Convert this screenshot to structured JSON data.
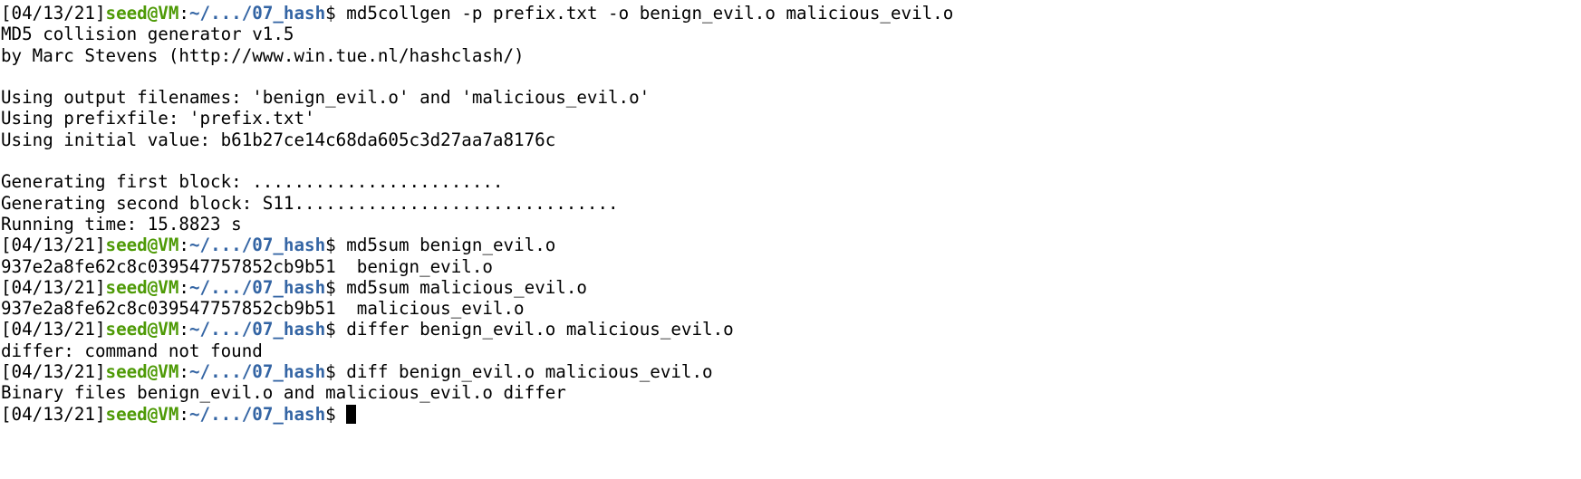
{
  "prompt": {
    "date": "[04/13/21]",
    "user": "seed@VM",
    "sep": ":",
    "path": "~/.../07_hash",
    "symbol": "$ "
  },
  "colors": {
    "user": "#4e9a06",
    "path": "#3465a4",
    "text": "#000000",
    "background": "#ffffff"
  },
  "lines": [
    {
      "type": "cmd",
      "text": "md5collgen -p prefix.txt -o benign_evil.o malicious_evil.o"
    },
    {
      "type": "out",
      "text": "MD5 collision generator v1.5"
    },
    {
      "type": "out",
      "text": "by Marc Stevens (http://www.win.tue.nl/hashclash/)"
    },
    {
      "type": "out",
      "text": ""
    },
    {
      "type": "out",
      "text": "Using output filenames: 'benign_evil.o' and 'malicious_evil.o'"
    },
    {
      "type": "out",
      "text": "Using prefixfile: 'prefix.txt'"
    },
    {
      "type": "out",
      "text": "Using initial value: b61b27ce14c68da605c3d27aa7a8176c"
    },
    {
      "type": "out",
      "text": ""
    },
    {
      "type": "out",
      "text": "Generating first block: ........................"
    },
    {
      "type": "out",
      "text": "Generating second block: S11..............................."
    },
    {
      "type": "out",
      "text": "Running time: 15.8823 s"
    },
    {
      "type": "cmd",
      "text": "md5sum benign_evil.o"
    },
    {
      "type": "out",
      "text": "937e2a8fe62c8c039547757852cb9b51  benign_evil.o"
    },
    {
      "type": "cmd",
      "text": "md5sum malicious_evil.o"
    },
    {
      "type": "out",
      "text": "937e2a8fe62c8c039547757852cb9b51  malicious_evil.o"
    },
    {
      "type": "cmd",
      "text": "differ benign_evil.o malicious_evil.o"
    },
    {
      "type": "out",
      "text": "differ: command not found"
    },
    {
      "type": "cmd",
      "text": "diff benign_evil.o malicious_evil.o"
    },
    {
      "type": "out",
      "text": "Binary files benign_evil.o and malicious_evil.o differ"
    },
    {
      "type": "cmd",
      "text": "",
      "cursor": true
    }
  ]
}
